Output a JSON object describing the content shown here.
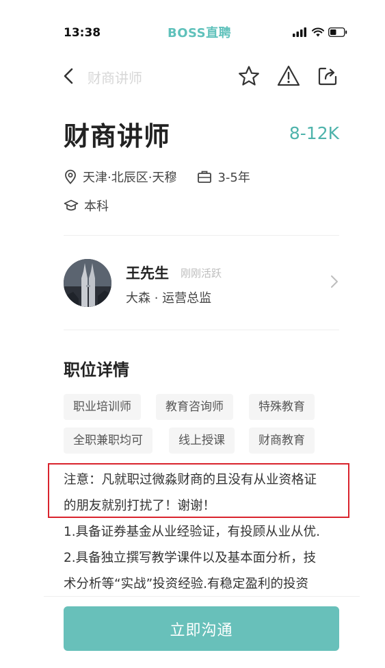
{
  "status_bar": {
    "time": "13:38",
    "brand": "BOSS直聘"
  },
  "nav": {
    "title": "财商讲师"
  },
  "job": {
    "title": "财商讲师",
    "salary": "8-12K",
    "location": "天津·北辰区·天穆",
    "experience": "3-5年",
    "education": "本科"
  },
  "recruiter": {
    "name": "王先生",
    "status": "刚刚活跃",
    "role": "大森 · 运营总监"
  },
  "details": {
    "section_title": "职位详情",
    "tags": [
      "职业培训师",
      "教育咨询师",
      "特殊教育",
      "全职兼职均可",
      "线上授课",
      "财商教育"
    ],
    "lines": [
      "注意：凡就职过微淼财商的且没有从业资格证",
      "的朋友就别打扰了！谢谢！",
      "1.具备证券基金从业经验证，有投顾从业从优.",
      "2.具备独立撰写教学课件以及基本面分析，技",
      "术分析等“实战”投资经验.有稳定盈利的投资"
    ]
  },
  "cta": {
    "label": "立即沟通"
  },
  "colors": {
    "accent": "#4eb3ab",
    "button": "#68c0ba",
    "highlight_border": "#d9232c"
  }
}
